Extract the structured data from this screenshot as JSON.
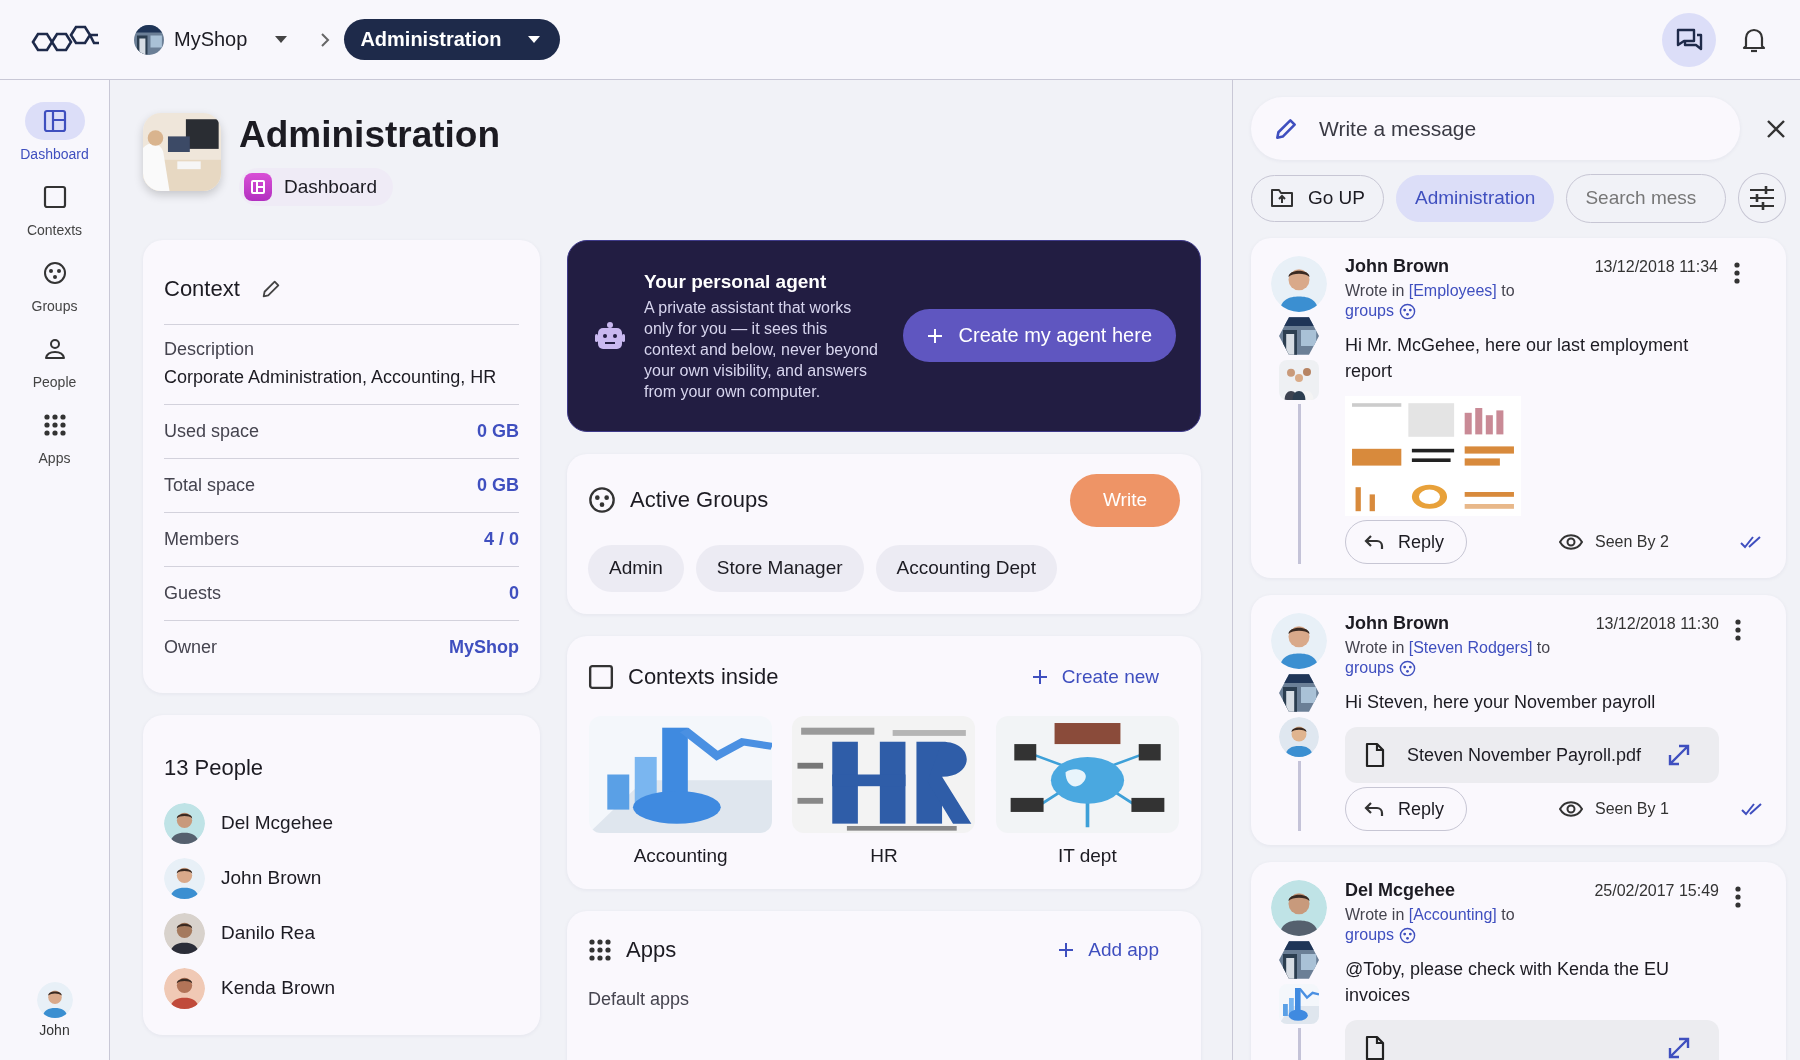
{
  "topbar": {
    "org": "MyShop",
    "current": "Administration",
    "chat_active": true
  },
  "sidebar": {
    "items": [
      {
        "label": "Dashboard",
        "selected": true
      },
      {
        "label": "Contexts",
        "selected": false
      },
      {
        "label": "Groups",
        "selected": false
      },
      {
        "label": "People",
        "selected": false
      },
      {
        "label": "Apps",
        "selected": false
      }
    ],
    "user": "John"
  },
  "header": {
    "title": "Administration",
    "view": "Dashboard"
  },
  "context_card": {
    "title": "Context",
    "description_label": "Description",
    "description": "Corporate Administration, Accounting, HR",
    "rows": [
      {
        "label": "Used space",
        "value": "0 GB"
      },
      {
        "label": "Total space",
        "value": "0 GB"
      },
      {
        "label": "Members",
        "value": "4 / 0"
      },
      {
        "label": "Guests",
        "value": "0"
      },
      {
        "label": "Owner",
        "value": "MyShop"
      }
    ]
  },
  "people_card": {
    "title": "13 People",
    "people": [
      "Del Mcgehee",
      "John Brown",
      "Danilo Rea",
      "Kenda Brown"
    ]
  },
  "agent_card": {
    "title": "Your personal agent",
    "text": "A private assistant that works only for you — it sees this context and below, never beyond your own visibility, and answers from your own computer.",
    "button": "Create my agent here"
  },
  "groups_card": {
    "title": "Active Groups",
    "button": "Write",
    "groups": [
      "Admin",
      "Store Manager",
      "Accounting Dept"
    ]
  },
  "contexts_card": {
    "title": "Contexts inside",
    "action": "Create new",
    "contexts": [
      "Accounting",
      "HR",
      "IT dept"
    ]
  },
  "apps_card": {
    "title": "Apps",
    "action": "Add app",
    "subtitle": "Default apps"
  },
  "messages": {
    "compose_placeholder": "Write a message",
    "go_up": "Go UP",
    "scope": "Administration",
    "search_placeholder": "Search mess",
    "items": [
      {
        "author": "John Brown",
        "time": "13/12/2018 11:34",
        "prefix": "Wrote in",
        "channel": "[Employees]",
        "suffix": "to",
        "recipients": "groups",
        "text": "Hi Mr. McGehee, here our last employment report",
        "reply": "Reply",
        "seen": "Seen By 2"
      },
      {
        "author": "John Brown",
        "time": "13/12/2018 11:30",
        "prefix": "Wrote in",
        "channel": "[Steven Rodgers]",
        "suffix": "to",
        "recipients": "groups",
        "text": "Hi Steven, here your November payroll",
        "attachment": {
          "kind": "file",
          "name": "Steven November Payroll.pdf"
        },
        "reply": "Reply",
        "seen": "Seen By 1"
      },
      {
        "author": "Del Mcgehee",
        "time": "25/02/2017 15:49",
        "prefix": "Wrote in",
        "channel": "[Accounting]",
        "suffix": "to",
        "recipients": "groups",
        "text": "@Toby, please check with Kenda the EU invoices",
        "attachment": {
          "kind": "file"
        }
      }
    ]
  }
}
